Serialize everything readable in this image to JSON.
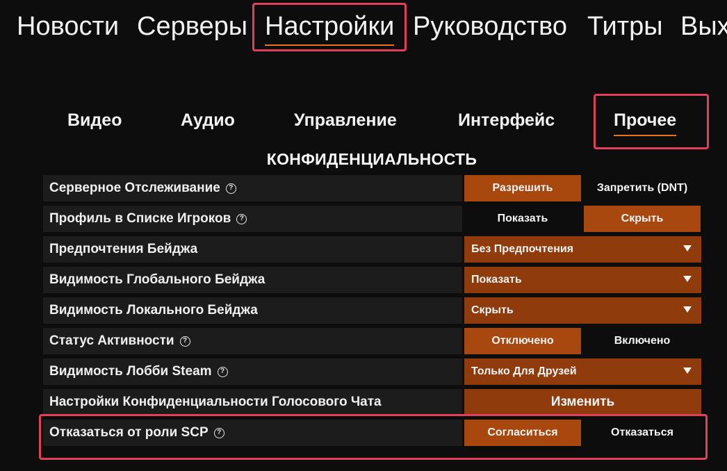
{
  "top_nav": {
    "tabs": [
      {
        "label": "Новости"
      },
      {
        "label": "Серверы"
      },
      {
        "label": "Настройки",
        "active": true
      },
      {
        "label": "Руководство"
      },
      {
        "label": "Титры"
      },
      {
        "label": "Выход"
      }
    ]
  },
  "sub_tabs": [
    {
      "label": "Видео"
    },
    {
      "label": "Аудио"
    },
    {
      "label": "Управление"
    },
    {
      "label": "Интерфейс"
    },
    {
      "label": "Прочее",
      "active": true
    }
  ],
  "section": {
    "title": "КОНФИДЕНЦИАЛЬНОСТЬ"
  },
  "settings": [
    {
      "label": "Серверное Отслеживание",
      "help": true,
      "type": "toggle",
      "options": [
        "Разрешить",
        "Запретить (DNT)"
      ],
      "selected": 0
    },
    {
      "label": "Профиль в Списке Игроков",
      "help": true,
      "type": "toggle",
      "options": [
        "Показать",
        "Скрыть"
      ],
      "selected": 1
    },
    {
      "label": "Предпочтения Бейджа",
      "help": false,
      "type": "dropdown",
      "value": "Без Предпочтения"
    },
    {
      "label": "Видимость Глобального Бейджа",
      "help": false,
      "type": "dropdown",
      "value": "Показать"
    },
    {
      "label": "Видимость Локального Бейджа",
      "help": false,
      "type": "dropdown",
      "value": "Скрыть"
    },
    {
      "label": "Статус Активности",
      "help": true,
      "type": "toggle",
      "options": [
        "Отключено",
        "Включено"
      ],
      "selected": 0
    },
    {
      "label": "Видимость Лобби Steam",
      "help": true,
      "type": "dropdown",
      "value": "Только Для Друзей"
    },
    {
      "label": "Настройки Конфиденциальности Голосового Чата",
      "help": false,
      "type": "button",
      "value": "Изменить"
    },
    {
      "label": "Отказаться от роли SCP",
      "help": true,
      "type": "toggle",
      "options": [
        "Согласиться",
        "Отказаться"
      ],
      "selected": 0
    }
  ],
  "help_glyph": "?",
  "colors": {
    "background": "#0d0d0d",
    "row_background": "#1c1c1c",
    "selected_option": "#a8480f",
    "dropdown": "#8f3b0b",
    "underline": "#e8741c",
    "highlight_box": "#e0405a"
  }
}
